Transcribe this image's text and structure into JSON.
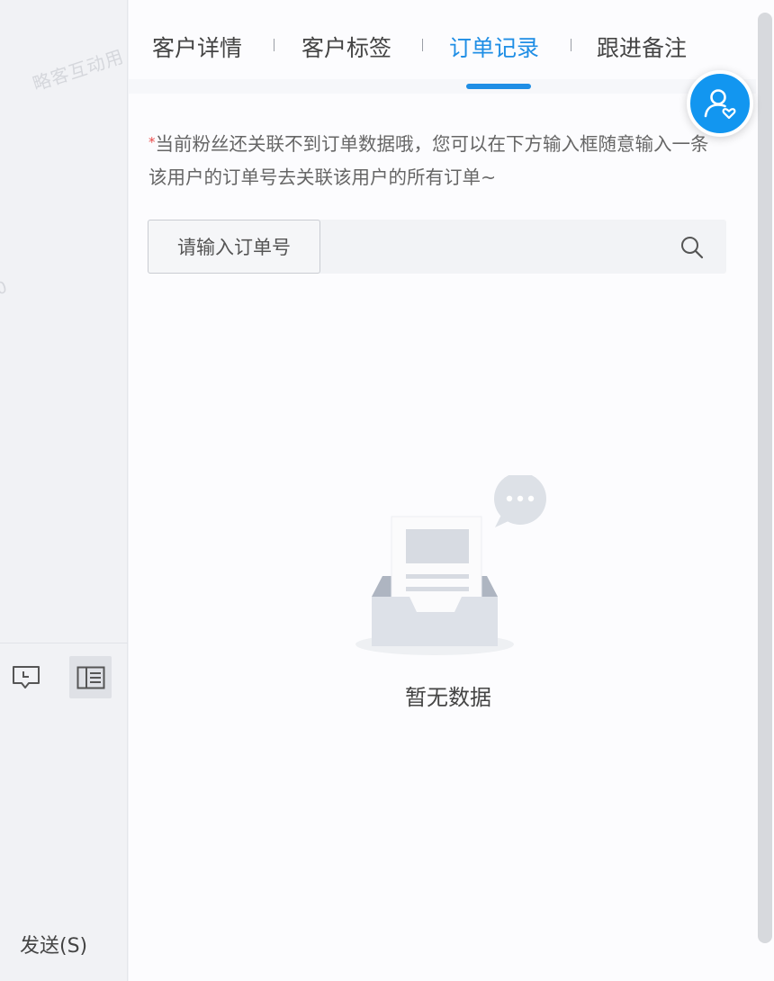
{
  "left_panel": {
    "watermark": "略客互动用",
    "watermark_fragment": "0",
    "toolbar": {
      "message_icon": "message-clock-icon",
      "panel_icon": "side-panel-icon"
    },
    "send_label": "发送(S)"
  },
  "tabs": [
    {
      "label": "客户详情",
      "active": false
    },
    {
      "label": "客户标签",
      "active": false
    },
    {
      "label": "订单记录",
      "active": true
    },
    {
      "label": "跟进备注",
      "active": false
    }
  ],
  "colors": {
    "accent": "#1f8ee5",
    "fab": "#1296f0",
    "required_star": "#e94b4b"
  },
  "customer_fab": {
    "icon": "user-heart-icon"
  },
  "notice": {
    "star": "*",
    "text": "当前粉丝还关联不到订单数据哦，您可以在下方输入框随意输入一条该用户的订单号去关联该用户的所有订单~"
  },
  "search": {
    "label": "请输入订单号",
    "value": "",
    "placeholder": "",
    "icon": "search-icon"
  },
  "empty_state": {
    "icon": "empty-inbox-icon",
    "text": "暂无数据"
  }
}
